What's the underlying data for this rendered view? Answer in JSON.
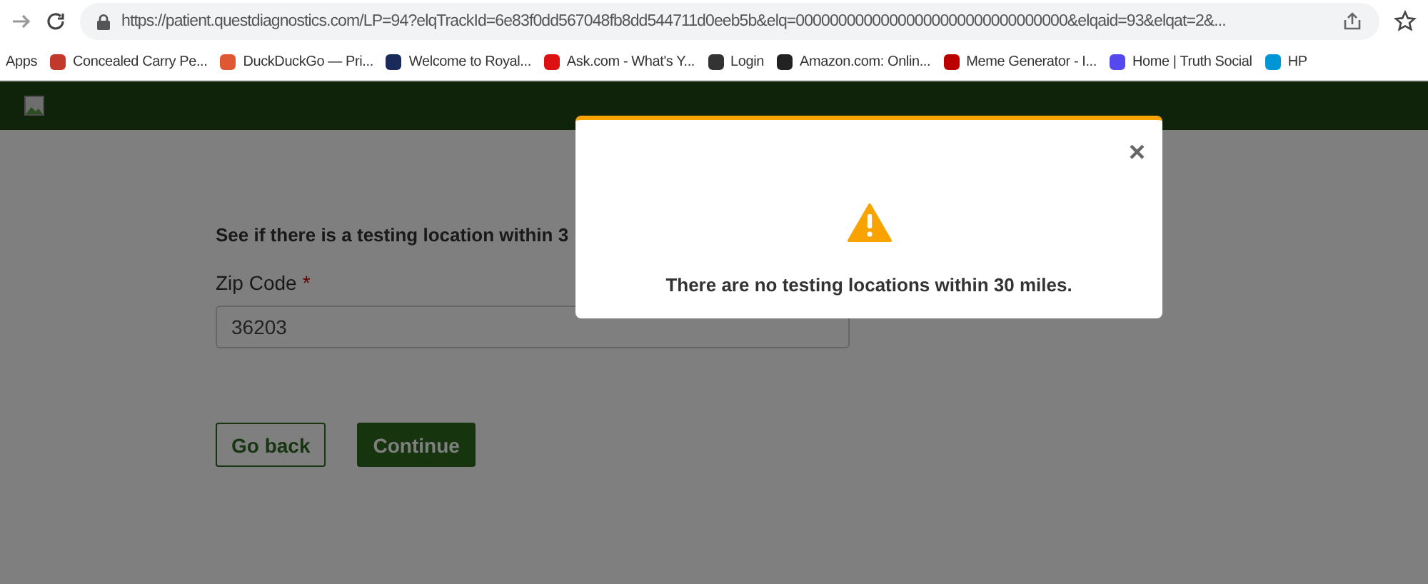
{
  "browser": {
    "url": "https://patient.questdiagnostics.com/LP=94?elqTrackId=6e83f0dd567048fb8dd544711d0eeb5b&elq=00000000000000000000000000000000&elqaid=93&elqat=2&...",
    "bookmarks": [
      {
        "label": "Apps",
        "kind": "apps"
      },
      {
        "label": "Concealed Carry Pe...",
        "kind": "uc"
      },
      {
        "label": "DuckDuckGo — Pri...",
        "kind": "duck"
      },
      {
        "label": "Welcome to Royal...",
        "kind": "royal"
      },
      {
        "label": "Ask.com - What's Y...",
        "kind": "ask"
      },
      {
        "label": "Login",
        "kind": "c"
      },
      {
        "label": "Amazon.com: Onlin...",
        "kind": "amazon"
      },
      {
        "label": "Meme Generator - I...",
        "kind": "meme"
      },
      {
        "label": "Home | Truth Social",
        "kind": "truth"
      },
      {
        "label": "HP",
        "kind": "hp"
      }
    ]
  },
  "form": {
    "heading": "See if there is a testing location within 3",
    "zip_label": "Zip Code",
    "required_mark": "*",
    "zip_value": "36203",
    "buttons": [
      {
        "label": "Go back",
        "kind": "outline"
      },
      {
        "label": "Continue",
        "kind": "primary"
      }
    ]
  },
  "modal": {
    "close": "×",
    "message": "There are no testing locations within 30 miles."
  }
}
